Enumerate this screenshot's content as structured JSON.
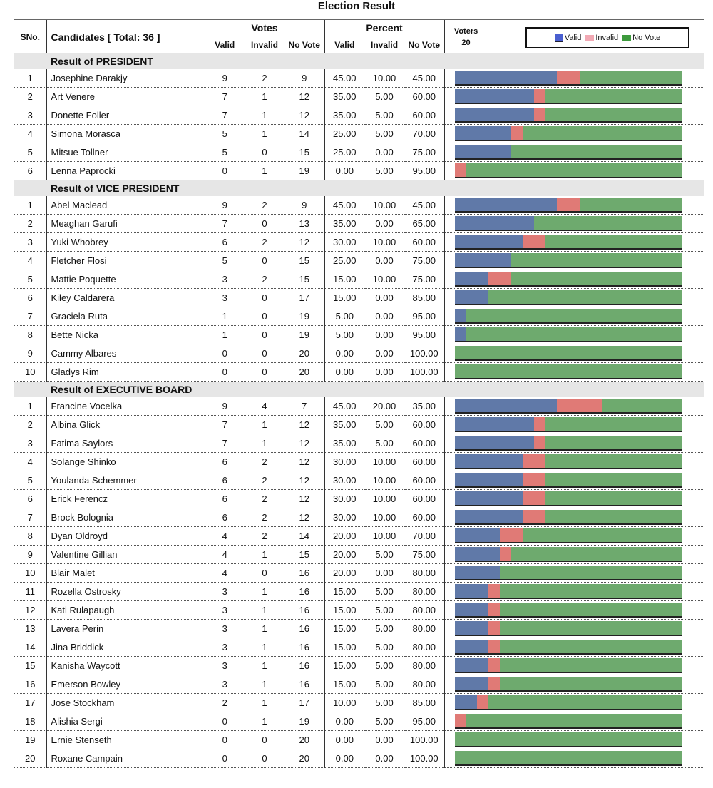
{
  "title": "Election Result",
  "header": {
    "sno": "SNo.",
    "candidates": "Candidates [ Total: 36 ]",
    "votes": "Votes",
    "percent": "Percent",
    "voters_label": "Voters",
    "voters_value": "20",
    "valid": "Valid",
    "invalid": "Invalid",
    "no_vote": "No Vote"
  },
  "legend": [
    {
      "label": "Valid",
      "color": "#6079a8"
    },
    {
      "label": "Invalid",
      "color": "#e07a76"
    },
    {
      "label": "No Vote",
      "color": "#6eaa6e"
    }
  ],
  "sections": [
    {
      "title": "Result of PRESIDENT",
      "rows": [
        [
          "1",
          "Josephine Darakjy",
          9,
          2,
          9,
          "45.00",
          "10.00",
          "45.00"
        ],
        [
          "2",
          "Art Venere",
          7,
          1,
          12,
          "35.00",
          "5.00",
          "60.00"
        ],
        [
          "3",
          "Donette Foller",
          7,
          1,
          12,
          "35.00",
          "5.00",
          "60.00"
        ],
        [
          "4",
          "Simona Morasca",
          5,
          1,
          14,
          "25.00",
          "5.00",
          "70.00"
        ],
        [
          "5",
          "Mitsue Tollner",
          5,
          0,
          15,
          "25.00",
          "0.00",
          "75.00"
        ],
        [
          "6",
          "Lenna Paprocki",
          0,
          1,
          19,
          "0.00",
          "5.00",
          "95.00"
        ]
      ]
    },
    {
      "title": "Result of VICE PRESIDENT",
      "rows": [
        [
          "1",
          "Abel Maclead",
          9,
          2,
          9,
          "45.00",
          "10.00",
          "45.00"
        ],
        [
          "2",
          "Meaghan Garufi",
          7,
          0,
          13,
          "35.00",
          "0.00",
          "65.00"
        ],
        [
          "3",
          "Yuki Whobrey",
          6,
          2,
          12,
          "30.00",
          "10.00",
          "60.00"
        ],
        [
          "4",
          "Fletcher Flosi",
          5,
          0,
          15,
          "25.00",
          "0.00",
          "75.00"
        ],
        [
          "5",
          "Mattie Poquette",
          3,
          2,
          15,
          "15.00",
          "10.00",
          "75.00"
        ],
        [
          "6",
          "Kiley Caldarera",
          3,
          0,
          17,
          "15.00",
          "0.00",
          "85.00"
        ],
        [
          "7",
          "Graciela Ruta",
          1,
          0,
          19,
          "5.00",
          "0.00",
          "95.00"
        ],
        [
          "8",
          "Bette Nicka",
          1,
          0,
          19,
          "5.00",
          "0.00",
          "95.00"
        ],
        [
          "9",
          "Cammy Albares",
          0,
          0,
          20,
          "0.00",
          "0.00",
          "100.00"
        ],
        [
          "10",
          "Gladys Rim",
          0,
          0,
          20,
          "0.00",
          "0.00",
          "100.00"
        ]
      ]
    },
    {
      "title": "Result of EXECUTIVE BOARD",
      "rows": [
        [
          "1",
          "Francine Vocelka",
          9,
          4,
          7,
          "45.00",
          "20.00",
          "35.00"
        ],
        [
          "2",
          "Albina Glick",
          7,
          1,
          12,
          "35.00",
          "5.00",
          "60.00"
        ],
        [
          "3",
          "Fatima Saylors",
          7,
          1,
          12,
          "35.00",
          "5.00",
          "60.00"
        ],
        [
          "4",
          "Solange Shinko",
          6,
          2,
          12,
          "30.00",
          "10.00",
          "60.00"
        ],
        [
          "5",
          "Youlanda Schemmer",
          6,
          2,
          12,
          "30.00",
          "10.00",
          "60.00"
        ],
        [
          "6",
          "Erick Ferencz",
          6,
          2,
          12,
          "30.00",
          "10.00",
          "60.00"
        ],
        [
          "7",
          "Brock Bolognia",
          6,
          2,
          12,
          "30.00",
          "10.00",
          "60.00"
        ],
        [
          "8",
          "Dyan Oldroyd",
          4,
          2,
          14,
          "20.00",
          "10.00",
          "70.00"
        ],
        [
          "9",
          "Valentine Gillian",
          4,
          1,
          15,
          "20.00",
          "5.00",
          "75.00"
        ],
        [
          "10",
          "Blair Malet",
          4,
          0,
          16,
          "20.00",
          "0.00",
          "80.00"
        ],
        [
          "11",
          "Rozella Ostrosky",
          3,
          1,
          16,
          "15.00",
          "5.00",
          "80.00"
        ],
        [
          "12",
          "Kati Rulapaugh",
          3,
          1,
          16,
          "15.00",
          "5.00",
          "80.00"
        ],
        [
          "13",
          "Lavera Perin",
          3,
          1,
          16,
          "15.00",
          "5.00",
          "80.00"
        ],
        [
          "14",
          "Jina Briddick",
          3,
          1,
          16,
          "15.00",
          "5.00",
          "80.00"
        ],
        [
          "15",
          "Kanisha Waycott",
          3,
          1,
          16,
          "15.00",
          "5.00",
          "80.00"
        ],
        [
          "16",
          "Emerson Bowley",
          3,
          1,
          16,
          "15.00",
          "5.00",
          "80.00"
        ],
        [
          "17",
          "Jose Stockham",
          2,
          1,
          17,
          "10.00",
          "5.00",
          "85.00"
        ],
        [
          "18",
          "Alishia Sergi",
          0,
          1,
          19,
          "0.00",
          "5.00",
          "95.00"
        ],
        [
          "19",
          "Ernie Stenseth",
          0,
          0,
          20,
          "0.00",
          "0.00",
          "100.00"
        ],
        [
          "20",
          "Roxane Campain",
          0,
          0,
          20,
          "0.00",
          "0.00",
          "100.00"
        ]
      ]
    }
  ]
}
